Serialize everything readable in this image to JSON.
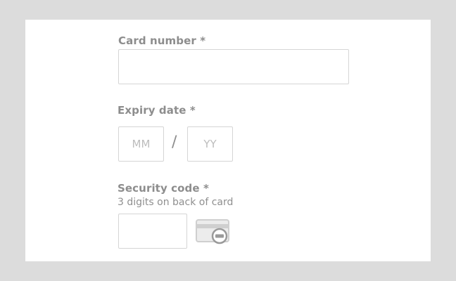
{
  "form": {
    "card_number": {
      "label": "Card number *",
      "value": ""
    },
    "expiry": {
      "label": "Expiry date *",
      "month_placeholder": "MM",
      "year_placeholder": "YY",
      "separator": "/"
    },
    "security_code": {
      "label": "Security code *",
      "hint": "3 digits on back of card",
      "value": ""
    }
  },
  "icons": {
    "card_security": "credit-card-security-icon"
  },
  "colors": {
    "background": "#dcdcdc",
    "panel": "#ffffff",
    "label": "#8d8d8d",
    "border": "#d5d5d5",
    "placeholder": "#bdbdbd"
  }
}
